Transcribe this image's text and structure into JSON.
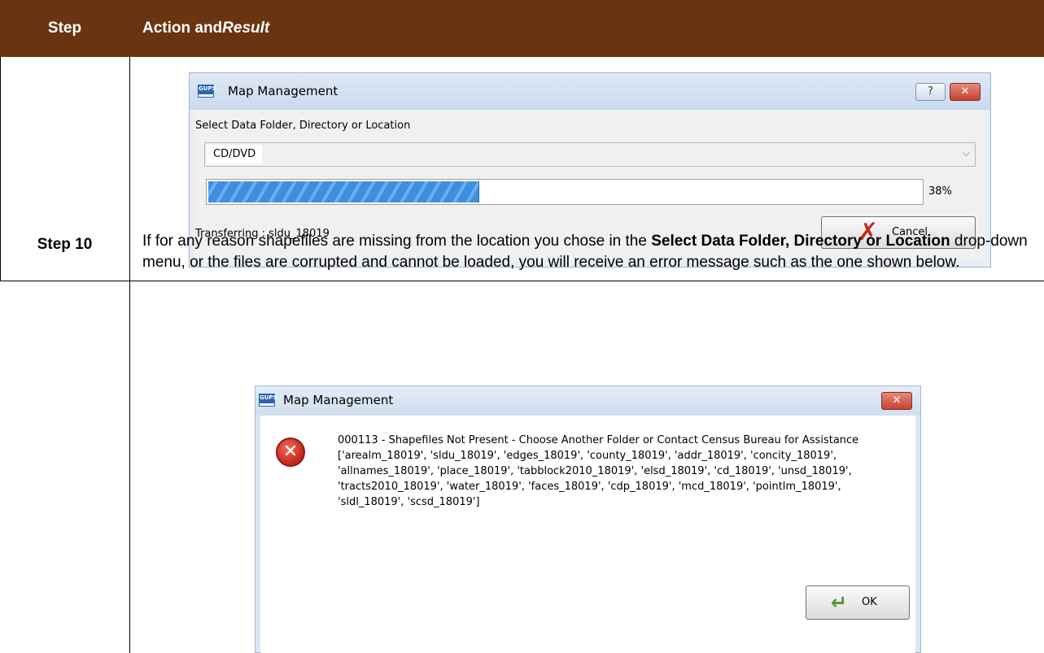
{
  "table": {
    "header_step": "Step",
    "header_action": "Action and ",
    "header_result": "Result"
  },
  "dialog_progress": {
    "title": "Map Management",
    "app_icon_text": "GUPS",
    "help_label": "?",
    "close_label": "✕",
    "select_label": "Select Data Folder, Directory or Location",
    "combo_value": "CD/DVD",
    "progress_fraction": 0.38,
    "percent_text": "38%",
    "status_text": "Transferring : sldu_18019",
    "cancel_label": "Cancel",
    "icons": {
      "cancel": "red-x-icon",
      "dropdown": "chevron-down-icon",
      "help": "help-icon",
      "close": "close-icon"
    }
  },
  "step10": {
    "label": "Step 10",
    "text_1": "If for any reason shapefiles are missing from the location you chose in the ",
    "bold_1": "Select Data Folder, Directory or Location",
    "text_2": " drop-down menu, or the files are corrupted and cannot be loaded, you will receive an error message such as the one shown below."
  },
  "dialog_error": {
    "title": "Map Management",
    "app_icon_text": "GUPS",
    "close_label": "✕",
    "message": "000113 - Shapefiles Not Present - Choose Another Folder or Contact Census Bureau for Assistance\n['arealm_18019', 'sldu_18019', 'edges_18019', 'county_18019', 'addr_18019', 'concity_18019', 'allnames_18019', 'place_18019', 'tabblock2010_18019', 'elsd_18019', 'cd_18019', 'unsd_18019', 'tracts2010_18019', 'water_18019', 'faces_18019', 'cdp_18019', 'mcd_18019', 'pointlm_18019', 'sldl_18019', 'scsd_18019']",
    "ok_label": "OK",
    "icons": {
      "error": "error-icon",
      "ok": "green-arrow-icon"
    }
  },
  "colors": {
    "header_bg": "#6a3410",
    "header_text": "#ffffff",
    "progress": "#3e8ee0",
    "error": "#c0271b"
  }
}
